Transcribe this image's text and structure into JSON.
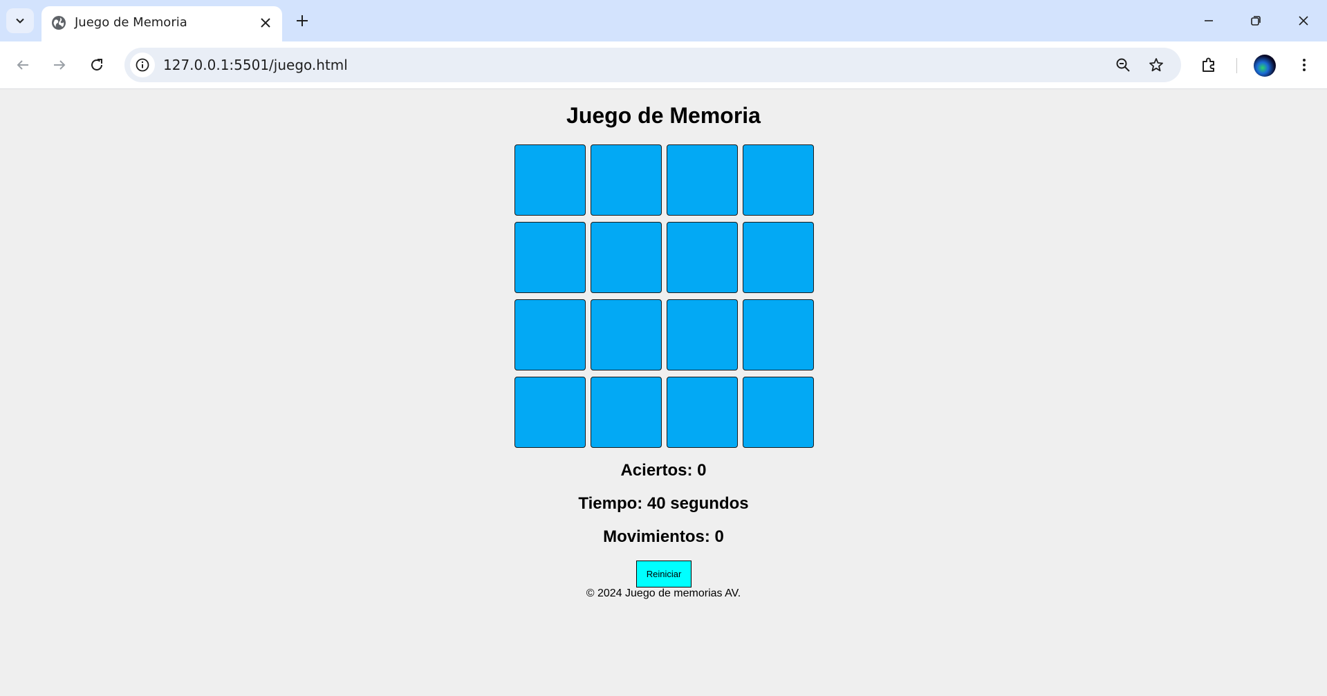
{
  "browser": {
    "tab_title": "Juego de Memoria",
    "url": "127.0.0.1:5501/juego.html"
  },
  "game": {
    "title": "Juego de Memoria",
    "card_color": "#03a9f4",
    "cards": [
      "",
      "",
      "",
      "",
      "",
      "",
      "",
      "",
      "",
      "",
      "",
      "",
      "",
      "",
      "",
      ""
    ],
    "aciertos": "Aciertos: 0",
    "tiempo": "Tiempo: 40 segundos",
    "movimientos": "Movimientos: 0",
    "restart_label": "Reiniciar",
    "restart_color": "#00ffff"
  },
  "footer": {
    "text": "© 2024 Juego de memorias AV."
  }
}
